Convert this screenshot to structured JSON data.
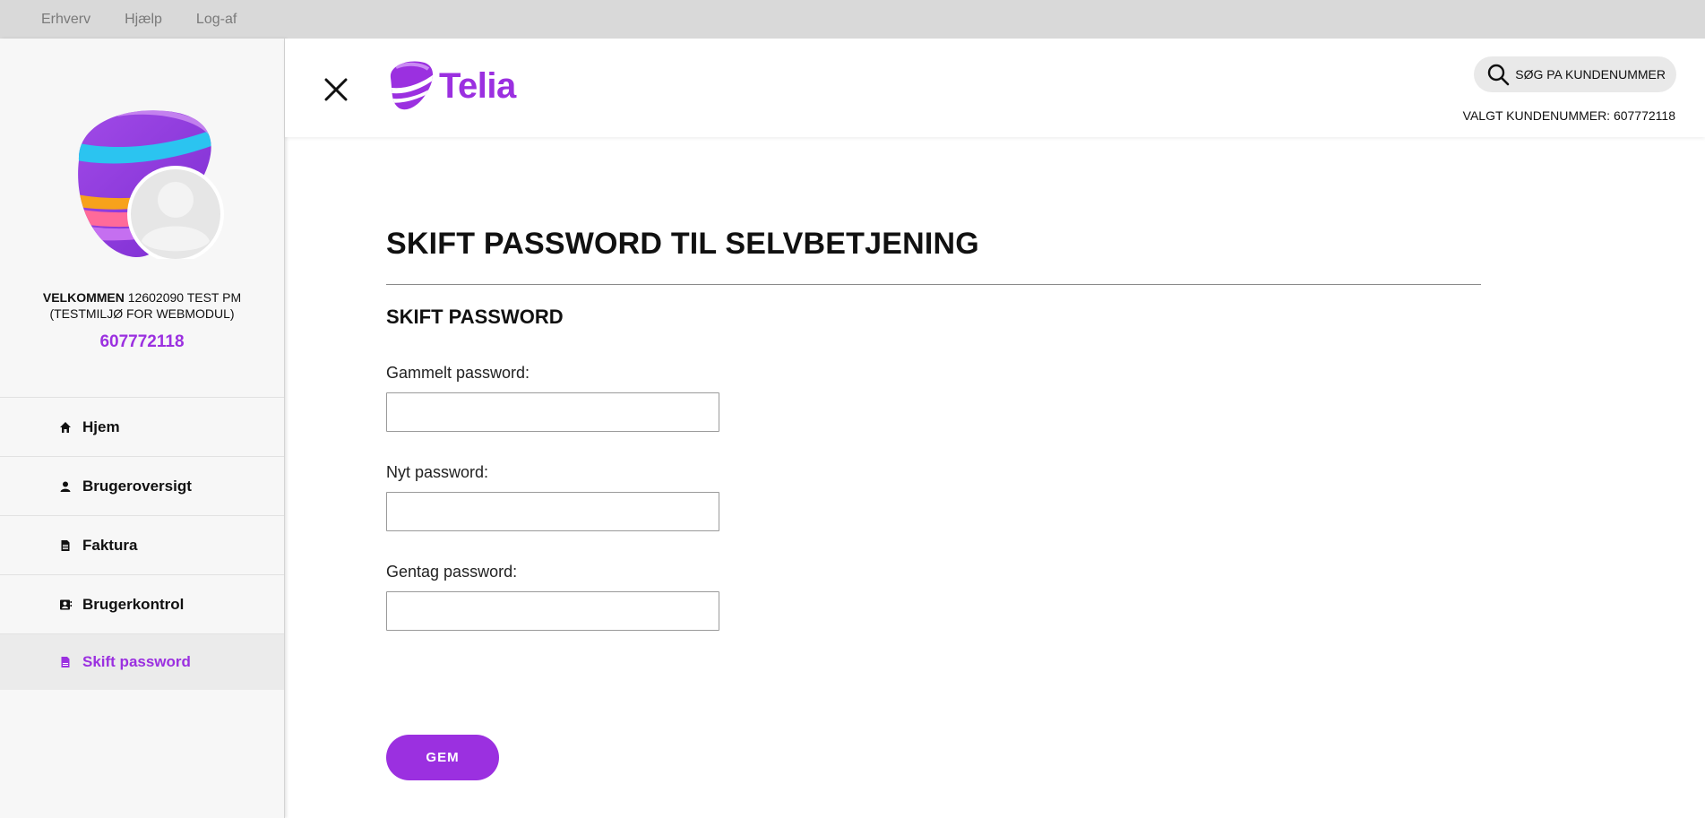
{
  "topbar": {
    "links": [
      "Erhverv",
      "Hjælp",
      "Log-af"
    ]
  },
  "sidebar": {
    "welcome_bold": "VELKOMMEN",
    "welcome_rest": " 12602090 TEST PM",
    "welcome_line2": "(TESTMILJØ FOR WEBMODUL)",
    "customer_number": "607772118",
    "items": [
      {
        "label": "Hjem",
        "icon": "home-icon"
      },
      {
        "label": "Brugeroversigt",
        "icon": "user-icon"
      },
      {
        "label": "Faktura",
        "icon": "invoice-icon"
      },
      {
        "label": "Brugerkontrol",
        "icon": "contact-card-icon"
      },
      {
        "label": "Skift password",
        "icon": "document-icon",
        "active": true
      }
    ]
  },
  "header": {
    "logo_text": "Telia",
    "search_label": "SØG PA KUNDENUMMER",
    "selected_customer": "VALGT KUNDENUMMER: 607772118"
  },
  "main": {
    "title": "SKIFT PASSWORD TIL SELVBETJENING",
    "section_title": "SKIFT PASSWORD",
    "fields": [
      {
        "label": "Gammelt password:",
        "value": ""
      },
      {
        "label": "Nyt password:",
        "value": ""
      },
      {
        "label": "Gentag password:",
        "value": ""
      }
    ],
    "save_label": "GEM"
  },
  "colors": {
    "accent": "#9b30e0",
    "topbar_bg": "#d9d9d9",
    "sidebar_bg": "#f7f7f7",
    "active_bg": "#ebebeb"
  }
}
